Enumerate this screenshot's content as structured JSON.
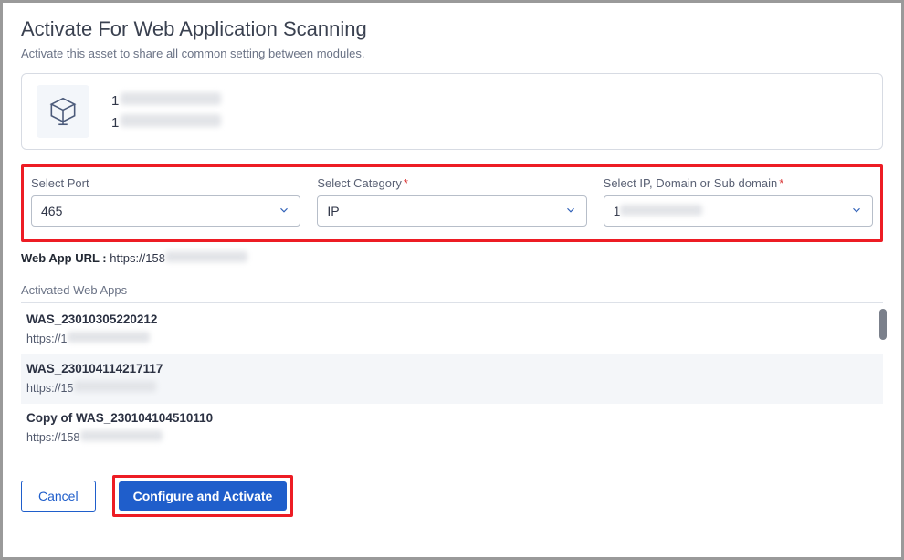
{
  "header": {
    "title": "Activate For Web Application Scanning",
    "subtitle": "Activate this asset to share all common setting between modules."
  },
  "asset": {
    "line1_prefix": "1",
    "line2_prefix": "1"
  },
  "selects": {
    "port": {
      "label": "Select Port",
      "required": false,
      "value": "465"
    },
    "category": {
      "label": "Select Category",
      "required": true,
      "value": "IP"
    },
    "ipdomain": {
      "label": "Select IP, Domain or Sub domain",
      "required": true,
      "value_prefix": "1"
    }
  },
  "webapp_url": {
    "label": "Web App URL :",
    "prefix": "https://158"
  },
  "activated": {
    "heading": "Activated Web Apps",
    "items": [
      {
        "name": "WAS_23010305220212",
        "url_prefix": "https://1"
      },
      {
        "name": "WAS_230104114217117",
        "url_prefix": "https://15"
      },
      {
        "name": "Copy of WAS_230104104510110",
        "url_prefix": "https://158"
      }
    ]
  },
  "buttons": {
    "cancel": "Cancel",
    "primary": "Configure and Activate"
  }
}
